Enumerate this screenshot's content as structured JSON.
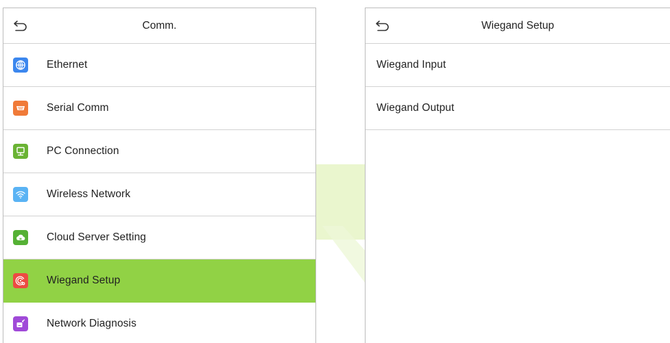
{
  "left_panel": {
    "title": "Comm.",
    "items": [
      {
        "label": "Ethernet",
        "icon": "globe-icon",
        "color": "#3c87ee"
      },
      {
        "label": "Serial Comm",
        "icon": "serial-port-icon",
        "color": "#f07a38"
      },
      {
        "label": "PC Connection",
        "icon": "monitor-icon",
        "color": "#6ab334"
      },
      {
        "label": "Wireless Network",
        "icon": "wifi-icon",
        "color": "#5ab3f4"
      },
      {
        "label": "Cloud Server Setting",
        "icon": "cloud-icon",
        "color": "#55b135"
      },
      {
        "label": "Wiegand Setup",
        "icon": "wiegand-icon",
        "color": "#ec4b42",
        "selected": true
      },
      {
        "label": "Network Diagnosis",
        "icon": "network-diagnosis-icon",
        "color": "#a04ad8"
      }
    ]
  },
  "right_panel": {
    "title": "Wiegand Setup",
    "items": [
      {
        "label": "Wiegand Input"
      },
      {
        "label": "Wiegand Output"
      }
    ]
  },
  "colors": {
    "selected_bg": "#91d245",
    "arrow": "#e4f4c4",
    "border": "#bcbcbc"
  }
}
